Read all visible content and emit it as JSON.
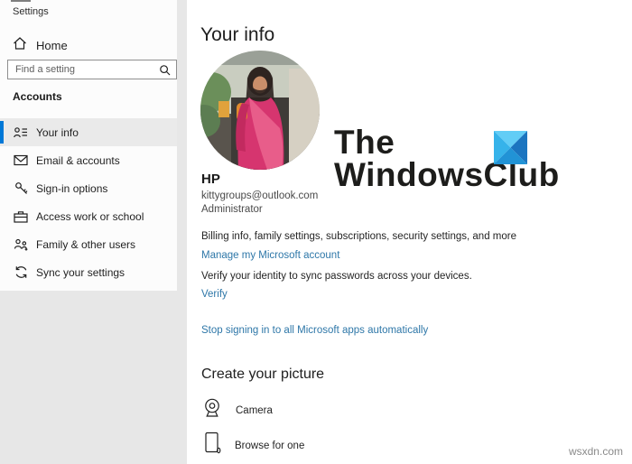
{
  "window": {
    "title": "Settings"
  },
  "sidebar": {
    "home_label": "Home",
    "search": {
      "placeholder": "Find a setting"
    },
    "section_heading": "Accounts",
    "items": [
      {
        "label": "Your info",
        "icon": "contact-info-icon",
        "selected": true
      },
      {
        "label": "Email & accounts",
        "icon": "email-icon",
        "selected": false
      },
      {
        "label": "Sign-in options",
        "icon": "key-icon",
        "selected": false
      },
      {
        "label": "Access work or school",
        "icon": "briefcase-icon",
        "selected": false
      },
      {
        "label": "Family & other users",
        "icon": "family-icon",
        "selected": false
      },
      {
        "label": "Sync your settings",
        "icon": "sync-icon",
        "selected": false
      }
    ]
  },
  "main": {
    "page_title": "Your info",
    "account": {
      "name": "HP",
      "email": "kittygroups@outlook.com",
      "role": "Administrator"
    },
    "billing_text": "Billing info, family settings, subscriptions, security settings, and more",
    "manage_link": "Manage my Microsoft account",
    "verify_text": "Verify your identity to sync passwords across your devices.",
    "verify_link": "Verify",
    "stop_link": "Stop signing in to all Microsoft apps automatically",
    "create_picture": {
      "heading": "Create your picture",
      "camera_label": "Camera",
      "browse_label": "Browse for one"
    }
  },
  "branding": {
    "logo_line1": "The",
    "logo_line2": "WindowsClub",
    "logo_colors": {
      "top": "#62cdf6",
      "left": "#36b3ea",
      "right": "#1b75c0",
      "bottom": "#2193d6"
    }
  },
  "watermark": "wsxdn.com",
  "colors": {
    "accent": "#0078d7",
    "link": "#2e77a8",
    "canvas_gray": "#e7e7e7"
  }
}
